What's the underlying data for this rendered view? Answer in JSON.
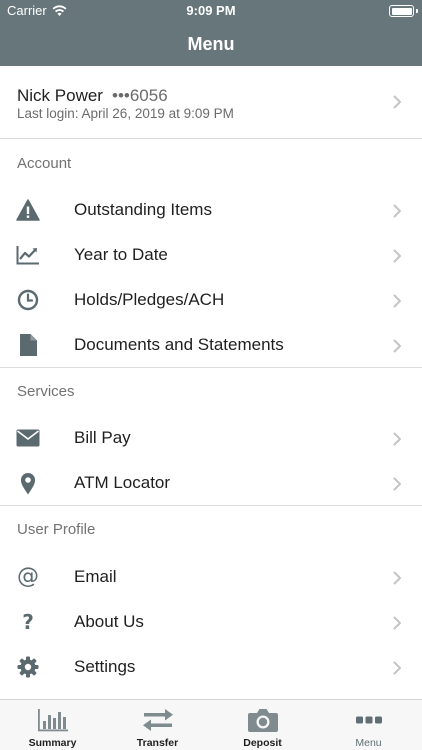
{
  "status": {
    "carrier": "Carrier",
    "time": "9:09 PM"
  },
  "nav": {
    "title": "Menu"
  },
  "account": {
    "name": "Nick Power",
    "masked_number": "•••6056",
    "last_login": "Last login: April 26, 2019 at 9:09 PM"
  },
  "sections": {
    "account": {
      "header": "Account",
      "items": [
        {
          "label": "Outstanding Items",
          "icon": "warning-icon"
        },
        {
          "label": "Year to Date",
          "icon": "trend-chart-icon"
        },
        {
          "label": "Holds/Pledges/ACH",
          "icon": "clock-icon"
        },
        {
          "label": "Documents and Statements",
          "icon": "document-icon"
        }
      ]
    },
    "services": {
      "header": "Services",
      "items": [
        {
          "label": "Bill Pay",
          "icon": "envelope-icon"
        },
        {
          "label": "ATM Locator",
          "icon": "map-pin-icon"
        }
      ]
    },
    "user_profile": {
      "header": "User Profile",
      "items": [
        {
          "label": "Email",
          "icon": "at-sign-icon"
        },
        {
          "label": "About Us",
          "icon": "question-icon"
        },
        {
          "label": "Settings",
          "icon": "gear-icon"
        }
      ]
    }
  },
  "tabbar": {
    "tabs": [
      {
        "label": "Summary",
        "icon": "bar-chart-icon"
      },
      {
        "label": "Transfer",
        "icon": "transfer-arrows-icon"
      },
      {
        "label": "Deposit",
        "icon": "camera-icon"
      },
      {
        "label": "Menu",
        "icon": "more-dots-icon",
        "active": true
      }
    ]
  },
  "colors": {
    "header_bg": "#67767b",
    "icon": "#5a6a6f",
    "chevron": "#c4c4c4",
    "active_tab": "#5f6f74"
  }
}
